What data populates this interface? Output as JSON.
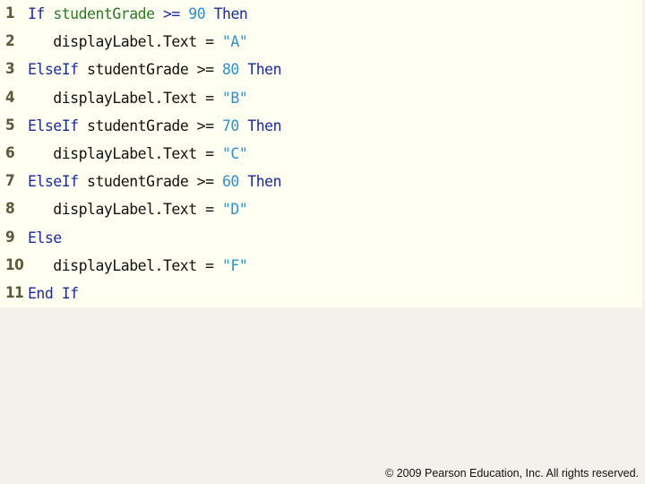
{
  "code_lines": [
    {
      "number": "1",
      "tokens": [
        {
          "t": "If",
          "c": "kw"
        },
        {
          "t": " ",
          "c": "plain"
        },
        {
          "t": "studentGrade",
          "c": "id"
        },
        {
          "t": " >= ",
          "c": "kw"
        },
        {
          "t": "90",
          "c": "num"
        },
        {
          "t": " Then",
          "c": "kw"
        }
      ]
    },
    {
      "number": "2",
      "tokens": [
        {
          "t": "   displayLabel.Text = ",
          "c": "plain"
        },
        {
          "t": "\"A\"",
          "c": "str"
        }
      ]
    },
    {
      "number": "3",
      "tokens": [
        {
          "t": "ElseIf",
          "c": "kw"
        },
        {
          "t": " studentGrade >= ",
          "c": "plain"
        },
        {
          "t": "80",
          "c": "num"
        },
        {
          "t": " Then",
          "c": "kw"
        }
      ]
    },
    {
      "number": "4",
      "tokens": [
        {
          "t": "   displayLabel.Text = ",
          "c": "plain"
        },
        {
          "t": "\"B\"",
          "c": "str"
        }
      ]
    },
    {
      "number": "5",
      "tokens": [
        {
          "t": "ElseIf",
          "c": "kw"
        },
        {
          "t": " studentGrade >= ",
          "c": "plain"
        },
        {
          "t": "70",
          "c": "num"
        },
        {
          "t": " Then",
          "c": "kw"
        }
      ]
    },
    {
      "number": "6",
      "tokens": [
        {
          "t": "   displayLabel.Text = ",
          "c": "plain"
        },
        {
          "t": "\"C\"",
          "c": "str"
        }
      ]
    },
    {
      "number": "7",
      "tokens": [
        {
          "t": "ElseIf",
          "c": "kw"
        },
        {
          "t": " studentGrade >= ",
          "c": "plain"
        },
        {
          "t": "60",
          "c": "num"
        },
        {
          "t": " Then",
          "c": "kw"
        }
      ]
    },
    {
      "number": "8",
      "tokens": [
        {
          "t": "   displayLabel.Text = ",
          "c": "plain"
        },
        {
          "t": "\"D\"",
          "c": "str"
        }
      ]
    },
    {
      "number": "9",
      "tokens": [
        {
          "t": "Else",
          "c": "kw"
        }
      ]
    },
    {
      "number": "10",
      "tokens": [
        {
          "t": "   displayLabel.Text = ",
          "c": "plain"
        },
        {
          "t": "\"F\"",
          "c": "str"
        }
      ]
    },
    {
      "number": "11",
      "tokens": [
        {
          "t": "End If",
          "c": "kw"
        }
      ]
    }
  ],
  "footer": {
    "copyright": "© 2009 Pearson Education, Inc.  All rights reserved."
  }
}
